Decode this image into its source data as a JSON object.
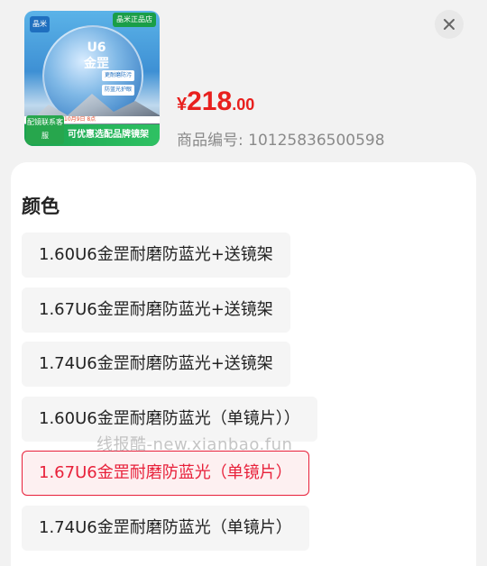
{
  "product": {
    "thumbnail": {
      "logo": "晶米",
      "badge": "晶米正品店",
      "title_line1": "U6",
      "title_line2": "金罡",
      "sub1": "更耐磨防污",
      "sub2": "防蓝光护眼",
      "promo": "10月9日 8点",
      "bottom": "可优惠选配品牌镜架",
      "contact": "配镜联系客服"
    },
    "price_currency": "¥",
    "price_integer": "218",
    "price_decimal": ".00",
    "sku_label": "商品编号:",
    "sku_value": "10125836500598"
  },
  "section": {
    "title": "颜色"
  },
  "options": [
    {
      "label": "1.60U6金罡耐磨防蓝光+送镜架",
      "selected": false
    },
    {
      "label": "1.67U6金罡耐磨防蓝光+送镜架",
      "selected": false
    },
    {
      "label": "1.74U6金罡耐磨防蓝光+送镜架",
      "selected": false
    },
    {
      "label": "1.60U6金罡耐磨防蓝光（单镜片））",
      "selected": false
    },
    {
      "label": "1.67U6金罡耐磨防蓝光（单镜片）",
      "selected": true
    },
    {
      "label": "1.74U6金罡耐磨防蓝光（单镜片）",
      "selected": false
    }
  ],
  "watermark": "线报酷-new.xianbao.fun",
  "colors": {
    "price": "#e8201e",
    "selected_border": "#e8203a",
    "selected_bg": "#fdf0f1"
  },
  "icons": {
    "close": "close-icon"
  }
}
